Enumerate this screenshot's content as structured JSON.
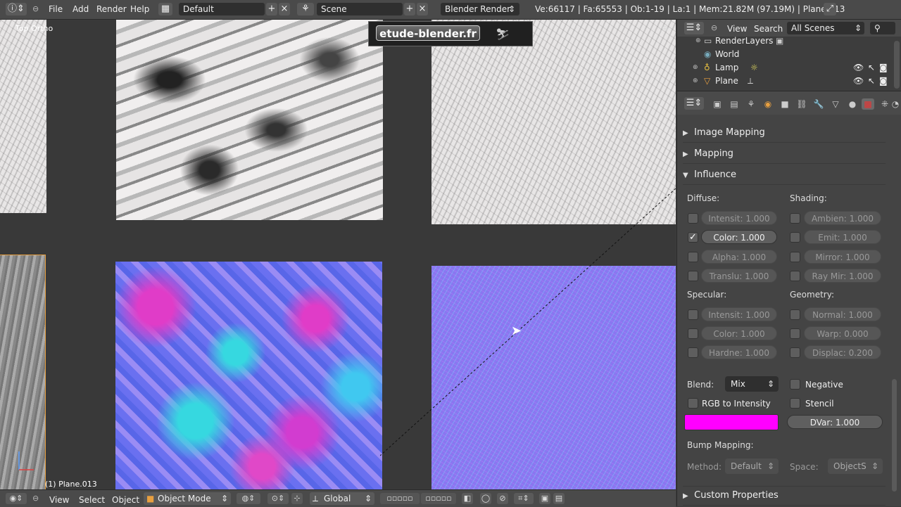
{
  "topbar": {
    "menus": [
      "File",
      "Add",
      "Render",
      "Help"
    ],
    "screen_layout": "Default",
    "scene": "Scene",
    "render_engine": "Blender Render",
    "stats": "Ve:66117 | Fa:65553 | Ob:1-19 | La:1 | Mem:21.82M (97.19M) | Plane.013"
  },
  "viewport": {
    "view_label": "Top Ortho",
    "object_label": "(1) Plane.013",
    "watermark": "etude-blender.fr"
  },
  "bottombar": {
    "view": "View",
    "select": "Select",
    "object": "Object",
    "mode": "Object Mode",
    "orientation": "Global"
  },
  "outliner": {
    "view": "View",
    "search": "Search",
    "filter": "All Scenes",
    "rows": [
      "RenderLayers",
      "World",
      "Lamp",
      "Plane"
    ]
  },
  "properties": {
    "panels": {
      "image_mapping": "Image Mapping",
      "mapping": "Mapping",
      "influence": "Influence",
      "custom_properties": "Custom Properties"
    },
    "diffuse_label": "Diffuse:",
    "shading_label": "Shading:",
    "specular_label": "Specular:",
    "geometry_label": "Geometry:",
    "diffuse": {
      "intensity": "Intensit: 1.000",
      "color": "Color: 1.000",
      "alpha": "Alpha: 1.000",
      "translu": "Translu: 1.000"
    },
    "shading": {
      "ambient": "Ambien: 1.000",
      "emit": "Emit: 1.000",
      "mirror": "Mirror: 1.000",
      "ray_mir": "Ray Mir: 1.000"
    },
    "specular": {
      "intensity": "Intensit: 1.000",
      "color": "Color: 1.000",
      "hardness": "Hardne: 1.000"
    },
    "geometry": {
      "normal": "Normal: 1.000",
      "warp": "Warp: 0.000",
      "displace": "Displac: 0.200"
    },
    "blend_label": "Blend:",
    "blend_value": "Mix",
    "negative": "Negative",
    "rgb_to_intensity": "RGB to Intensity",
    "stencil": "Stencil",
    "dvar": "DVar: 1.000",
    "blend_color": "#ff00ff",
    "bump_mapping_label": "Bump Mapping:",
    "method_label": "Method:",
    "method_value": "Default",
    "space_label": "Space:",
    "space_value": "ObjectS",
    "color_checked": "✓"
  }
}
